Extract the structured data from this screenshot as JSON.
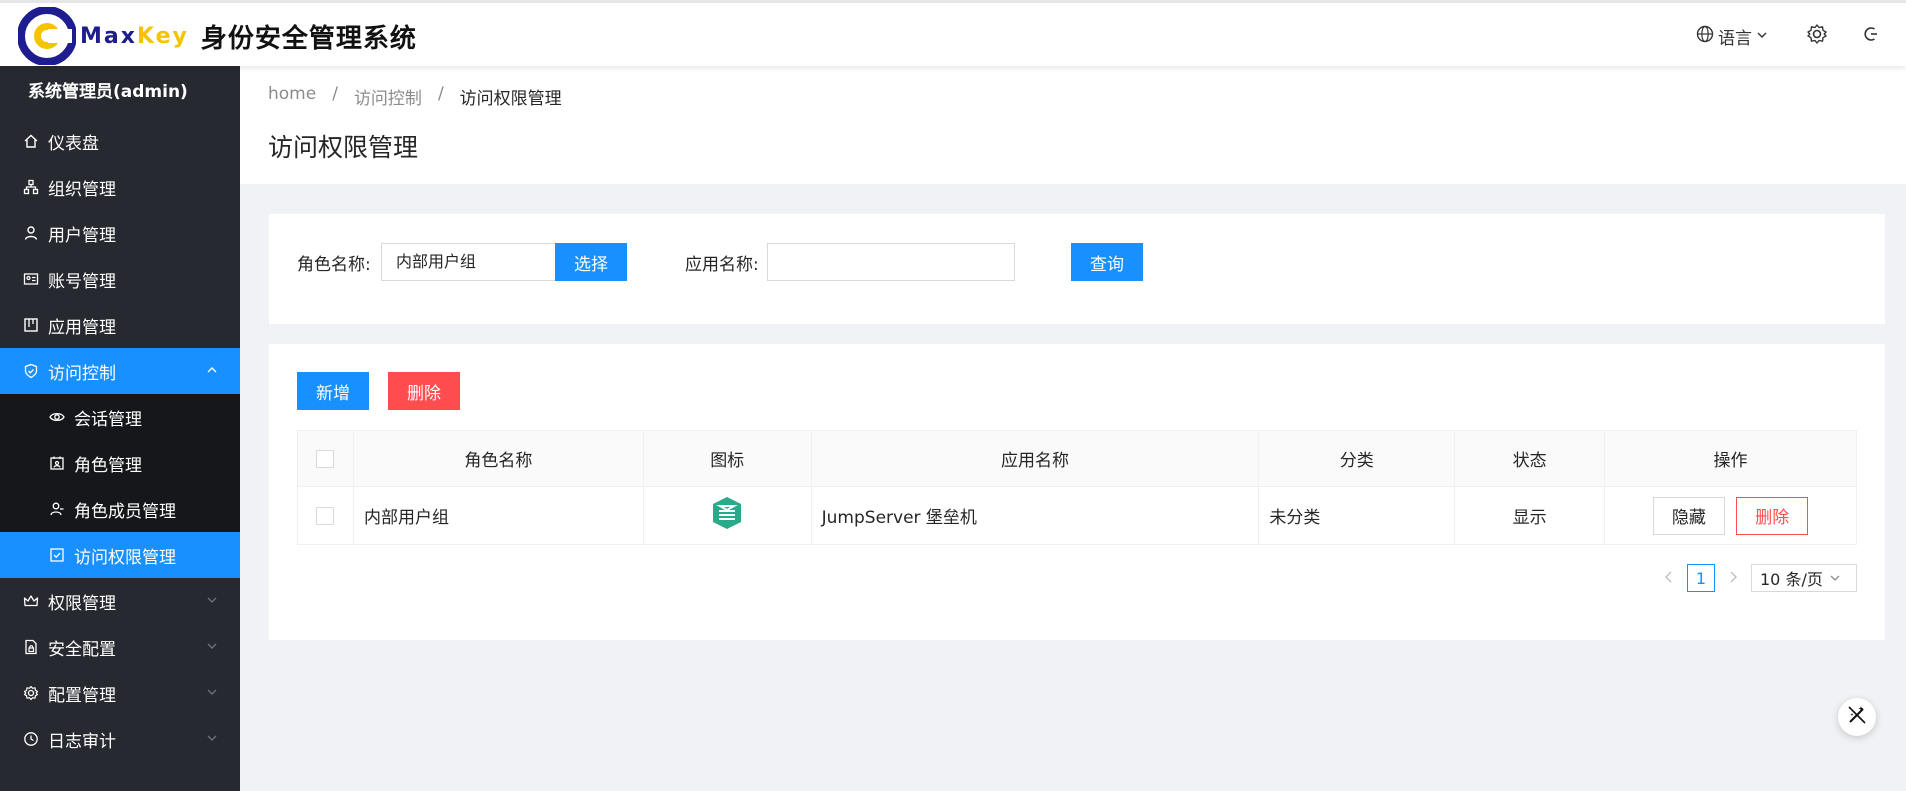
{
  "header": {
    "logo_max": "Max",
    "logo_key": "Key",
    "title": "身份安全管理系统",
    "language_label": "语言"
  },
  "sidebar": {
    "admin": "系统管理员(admin)",
    "items": [
      {
        "label": "仪表盘",
        "icon": "home-icon"
      },
      {
        "label": "组织管理",
        "icon": "org-tree-icon"
      },
      {
        "label": "用户管理",
        "icon": "user-icon"
      },
      {
        "label": "账号管理",
        "icon": "id-card-icon"
      },
      {
        "label": "应用管理",
        "icon": "app-icon"
      },
      {
        "label": "访问控制",
        "icon": "shield-icon"
      },
      {
        "label": "权限管理",
        "icon": "crown-icon"
      },
      {
        "label": "安全配置",
        "icon": "doc-lock-icon"
      },
      {
        "label": "配置管理",
        "icon": "gear-icon"
      },
      {
        "label": "日志审计",
        "icon": "clock-icon"
      }
    ],
    "sub_items": [
      {
        "label": "会话管理",
        "icon": "eye-icon"
      },
      {
        "label": "角色管理",
        "icon": "role-card-icon"
      },
      {
        "label": "角色成员管理",
        "icon": "members-icon"
      },
      {
        "label": "访问权限管理",
        "icon": "check-square-icon"
      }
    ]
  },
  "breadcrumb": {
    "home": "home",
    "section": "访问控制",
    "current": "访问权限管理",
    "sep": "/"
  },
  "page_title": "访问权限管理",
  "search": {
    "role_label": "角色名称:",
    "role_value": "内部用户组",
    "select_label": "选择",
    "app_label": "应用名称:",
    "app_value": "",
    "query_label": "查询"
  },
  "toolbar": {
    "add_label": "新增",
    "delete_label": "删除"
  },
  "table": {
    "headers": [
      "角色名称",
      "图标",
      "应用名称",
      "分类",
      "状态",
      "操作"
    ],
    "rows": [
      {
        "role": "内部用户组",
        "app": "JumpServer 堡垒机",
        "category": "未分类",
        "status": "显示",
        "hide_label": "隐藏",
        "delete_label": "删除"
      }
    ]
  },
  "pager": {
    "current": "1",
    "page_size": "10 条/页"
  },
  "colors": {
    "primary": "#1890ff",
    "danger": "#ff4d4f",
    "sidebar": "#262a30"
  }
}
